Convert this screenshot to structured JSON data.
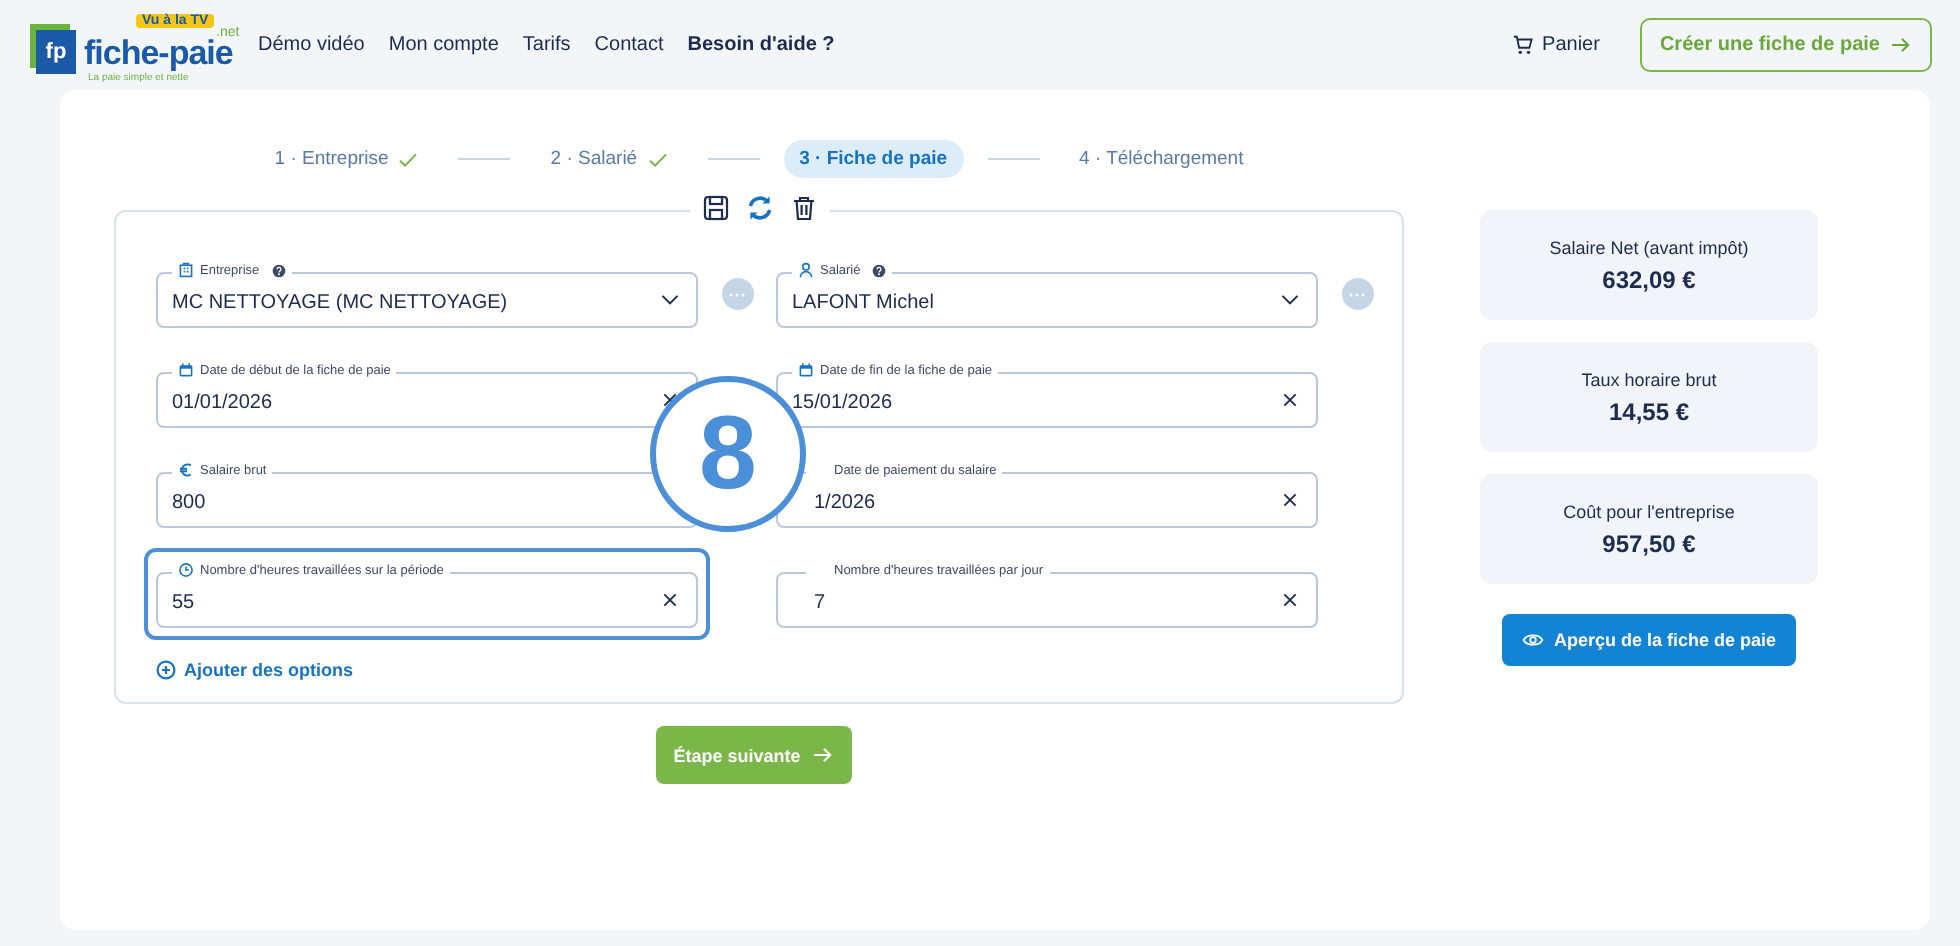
{
  "header": {
    "logo": {
      "badge": "Vu à la TV",
      "monogram": "fp",
      "name": "fiche-paie",
      "suffix": ".net",
      "tagline": "La paie simple et nette"
    },
    "nav": [
      {
        "label": "Démo vidéo",
        "bold": false
      },
      {
        "label": "Mon compte",
        "bold": false
      },
      {
        "label": "Tarifs",
        "bold": false
      },
      {
        "label": "Contact",
        "bold": false
      },
      {
        "label": "Besoin d'aide ?",
        "bold": true
      }
    ],
    "cart": "Panier",
    "cta": "Créer une fiche de paie"
  },
  "steps": [
    {
      "label": "1 · Entreprise",
      "done": true,
      "selected": false
    },
    {
      "label": "2 · Salarié",
      "done": true,
      "selected": false
    },
    {
      "label": "3 · Fiche de paie",
      "done": false,
      "selected": true
    },
    {
      "label": "4 · Téléchargement",
      "done": false,
      "selected": false
    }
  ],
  "fields": [
    {
      "label": "Entreprise",
      "help": true,
      "value": "MC NETTOYAGE (MC NETTOYAGE)",
      "kind": "select",
      "highlighted": false
    },
    {
      "label": "Salarié",
      "help": true,
      "value": "LAFONT Michel",
      "kind": "select",
      "highlighted": false
    },
    {
      "label": "Date de début de la fiche de paie",
      "help": false,
      "value": "01/01/2026",
      "kind": "clearable",
      "highlighted": false
    },
    {
      "label": "Date de fin de la fiche de paie",
      "help": false,
      "value": "15/01/2026",
      "kind": "clearable",
      "highlighted": false
    },
    {
      "label": "Salaire brut",
      "help": false,
      "value": "800",
      "kind": "plain",
      "highlighted": false
    },
    {
      "label": "Date de paiement du salaire",
      "help": false,
      "value": "1/2026",
      "kind": "clearable",
      "highlighted": false
    },
    {
      "label": "Nombre d'heures travaillées sur la période",
      "help": false,
      "value": "55",
      "kind": "clearable",
      "highlighted": true
    },
    {
      "label": "Nombre d'heures travaillées par jour",
      "help": false,
      "value": "7",
      "kind": "clearable",
      "highlighted": false
    }
  ],
  "add_options": "Ajouter des options",
  "annotation": "8",
  "next_button": "Étape suivante",
  "summary": [
    {
      "label": "Salaire Net (avant impôt)",
      "value": "632,09 €"
    },
    {
      "label": "Taux horaire brut",
      "value": "14,55 €"
    },
    {
      "label": "Coût pour l'entreprise",
      "value": "957,50 €"
    }
  ],
  "preview_button": "Aperçu de la fiche de paie"
}
